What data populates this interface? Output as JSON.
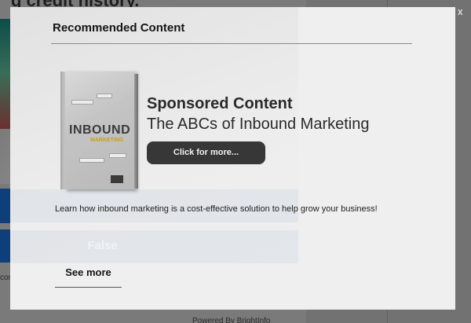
{
  "background": {
    "heading": "g credit history.",
    "left_partial_text": "con",
    "footer": "Powered By BrightInfo"
  },
  "modal": {
    "header": "Recommended Content",
    "book": {
      "cover_title": "INBOUND",
      "cover_subtitle": "MARKETING"
    },
    "sponsored_label": "Sponsored Content",
    "content_title": "The ABCs of Inbound Marketing",
    "cta_label": "Click for more...",
    "description": "Learn how inbound marketing is a cost-effective solution to help grow your business!",
    "ghost_option": "False",
    "see_more": "See more",
    "close_label": "x"
  },
  "colors": {
    "overlay": "#7a7a7a",
    "modal_bg": "#efefef",
    "cta_bg": "#373737",
    "cover_accent": "#c7a011"
  }
}
